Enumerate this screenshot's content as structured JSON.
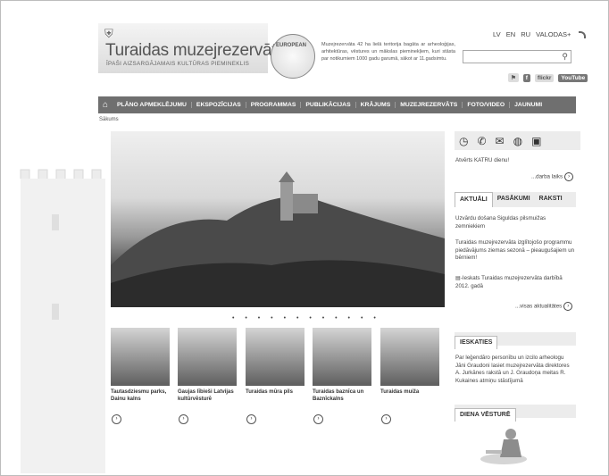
{
  "header": {
    "title": "Turaidas muzejrezervāts",
    "subtitle": "ĪPAŠI AIZSARGĀJAMAIS KULTŪRAS PIEMINEKLIS",
    "seal_text": "EUROPEAN",
    "intro": "Muzejrezervāta 42 ha lielā teritorija bagāta ar arheoloģijas, arhitektūras, vēstures un mākslas pieminekļiem, kuri stāsta par notikumiem 1000 gadu garumā, sākot ar 11.gadsimtu.",
    "languages": [
      "LV",
      "EN",
      "RU",
      "VALODAS+"
    ],
    "search_placeholder": "",
    "social": [
      "f",
      "flickr",
      "YouTube"
    ]
  },
  "nav": {
    "items": [
      "PLĀNO APMEKLĒJUMU",
      "EKSPOZĪCIJAS",
      "PROGRAMMAS",
      "PUBLIKĀCIJAS",
      "KRĀJUMS",
      "MUZEJREZERVĀTS",
      "FOTO/VIDEO",
      "JAUNUMI"
    ]
  },
  "breadcrumb": "Sākums",
  "slider": {
    "dots": "• • • • • • • • • • • •"
  },
  "tiles": [
    {
      "label": "Tautasdziesmu parks, Dainu kalns"
    },
    {
      "label": "Gaujas lībieši Latvijas kultūrvēsturē"
    },
    {
      "label": "Turaidas mūra pils"
    },
    {
      "label": "Turaidas baznīca un Baznīckalns"
    },
    {
      "label": "Turaidas muiža"
    }
  ],
  "sidebar": {
    "open_text": "Atvērts KATRU dienu!",
    "hours_link": "...darba laiks",
    "tabs": [
      "AKTUĀLI",
      "PASĀKUMI",
      "RAKSTI"
    ],
    "news": [
      "Uzvārdu došana Siguldas pilsmuižas zemniekiem",
      "Turaidas muzejrezervāta izglītojošo programmu piedāvājums ziemas sezonā – pieaugušajiem un bērniem!",
      "-Ieskats Turaidas muzejrezervāta darbībā 2012. gadā"
    ],
    "all_news": "...visas aktualitātes",
    "ieskaties_head": "IESKATIES",
    "ieskaties_text": "Par leģendāro personību un izcilo arheologu Jāni Graudoni lasiet muzejrezervāta direktores A. Jurkānes rakstā un J. Graudoņa meitas R. Kukaines atmiņu stāstījumā",
    "history_head": "DIENA VĒSTURĒ"
  }
}
